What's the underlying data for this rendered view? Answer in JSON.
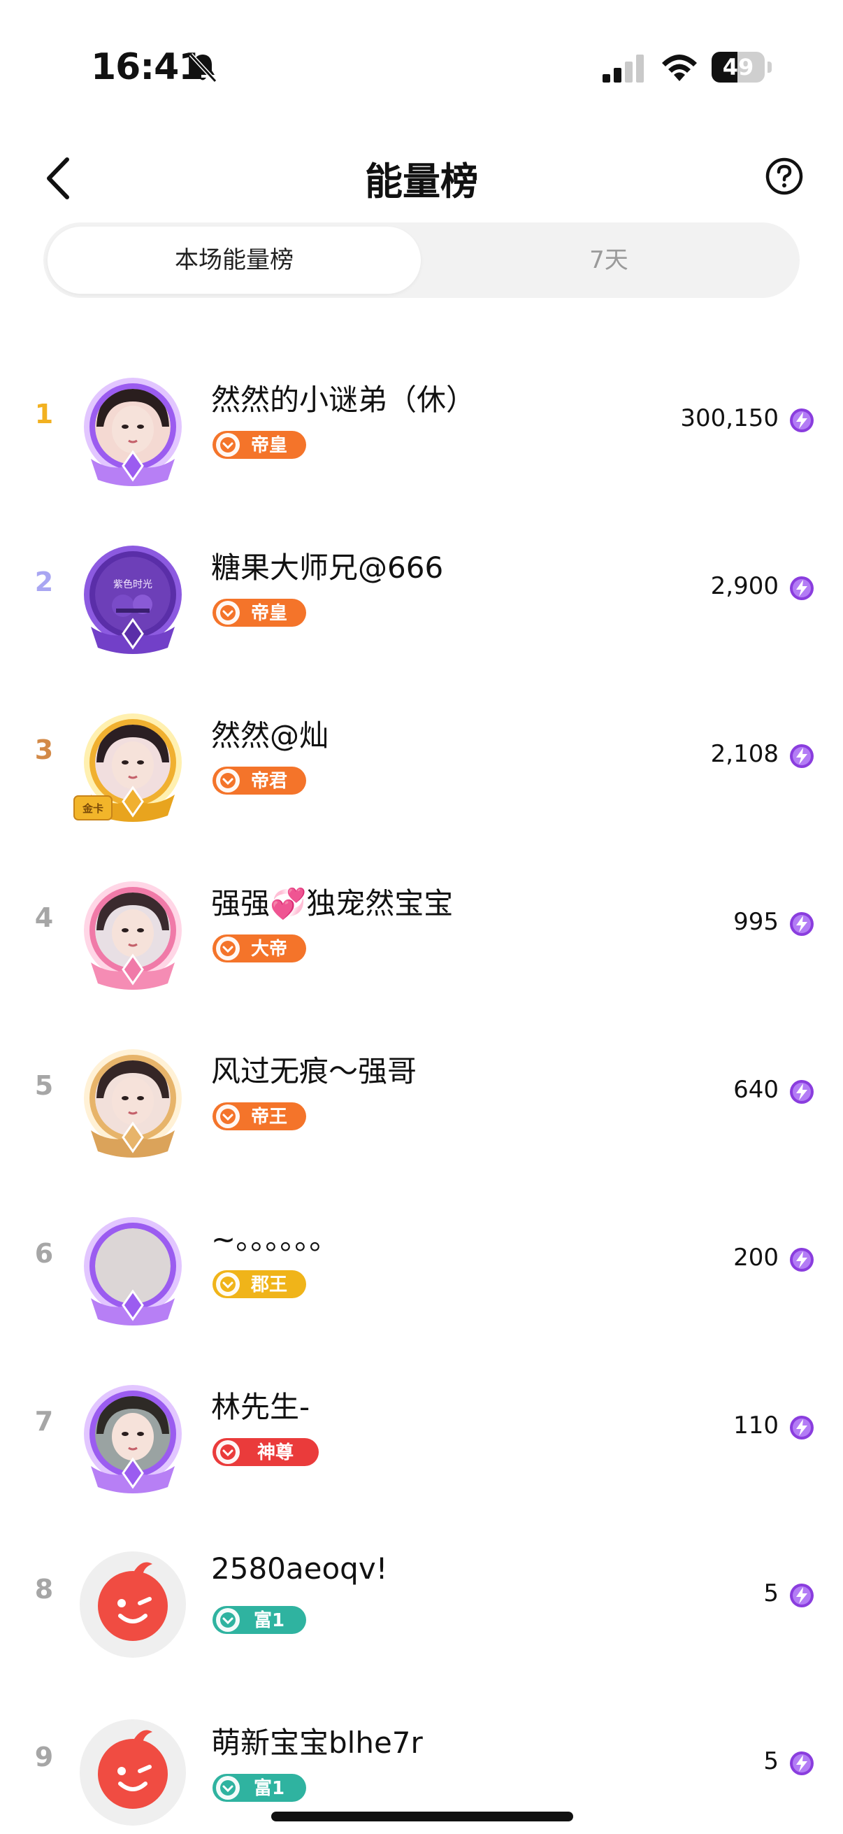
{
  "status_bar": {
    "time": "16:41",
    "battery": "49",
    "battery_percent": 49
  },
  "header": {
    "title": "能量榜"
  },
  "tabs": [
    {
      "label": "本场能量榜",
      "active": true
    },
    {
      "label": "7天",
      "active": false
    }
  ],
  "colors": {
    "rank1": "#f2b120",
    "rank2": "#a9a6f2",
    "rank3": "#d38a48",
    "rank_other": "#a6a6a6",
    "badge_orange": "#f4742a",
    "badge_gold": "#f0b419",
    "badge_red": "#ea3b3b",
    "badge_teal": "#2fb3a0",
    "energy_purple": "#8a3dde"
  },
  "entries": [
    {
      "rank": "1",
      "name": "然然的小谜弟（休）",
      "badge": "帝皇",
      "score": "300,150"
    },
    {
      "rank": "2",
      "name": "糖果大师兄@666",
      "badge": "帝皇",
      "score": "2,900",
      "frame_text": "紫色时光"
    },
    {
      "rank": "3",
      "name": "然然@灿",
      "badge": "帝君",
      "score": "2,108",
      "frame_tag": "金卡"
    },
    {
      "rank": "4",
      "name": "强强💞独宠然宝宝",
      "badge": "大帝",
      "score": "995"
    },
    {
      "rank": "5",
      "name": "风过无痕～强哥",
      "badge": "帝王",
      "score": "640"
    },
    {
      "rank": "6",
      "name": "~。。。。。。",
      "badge": "郡王",
      "score": "200"
    },
    {
      "rank": "7",
      "name": "林先生-",
      "badge": "神尊",
      "score": "110"
    },
    {
      "rank": "8",
      "name": "2580aeoqv!",
      "badge": "富1",
      "score": "5"
    },
    {
      "rank": "9",
      "name": "萌新宝宝blhe7r",
      "badge": "富1",
      "score": "5"
    }
  ]
}
